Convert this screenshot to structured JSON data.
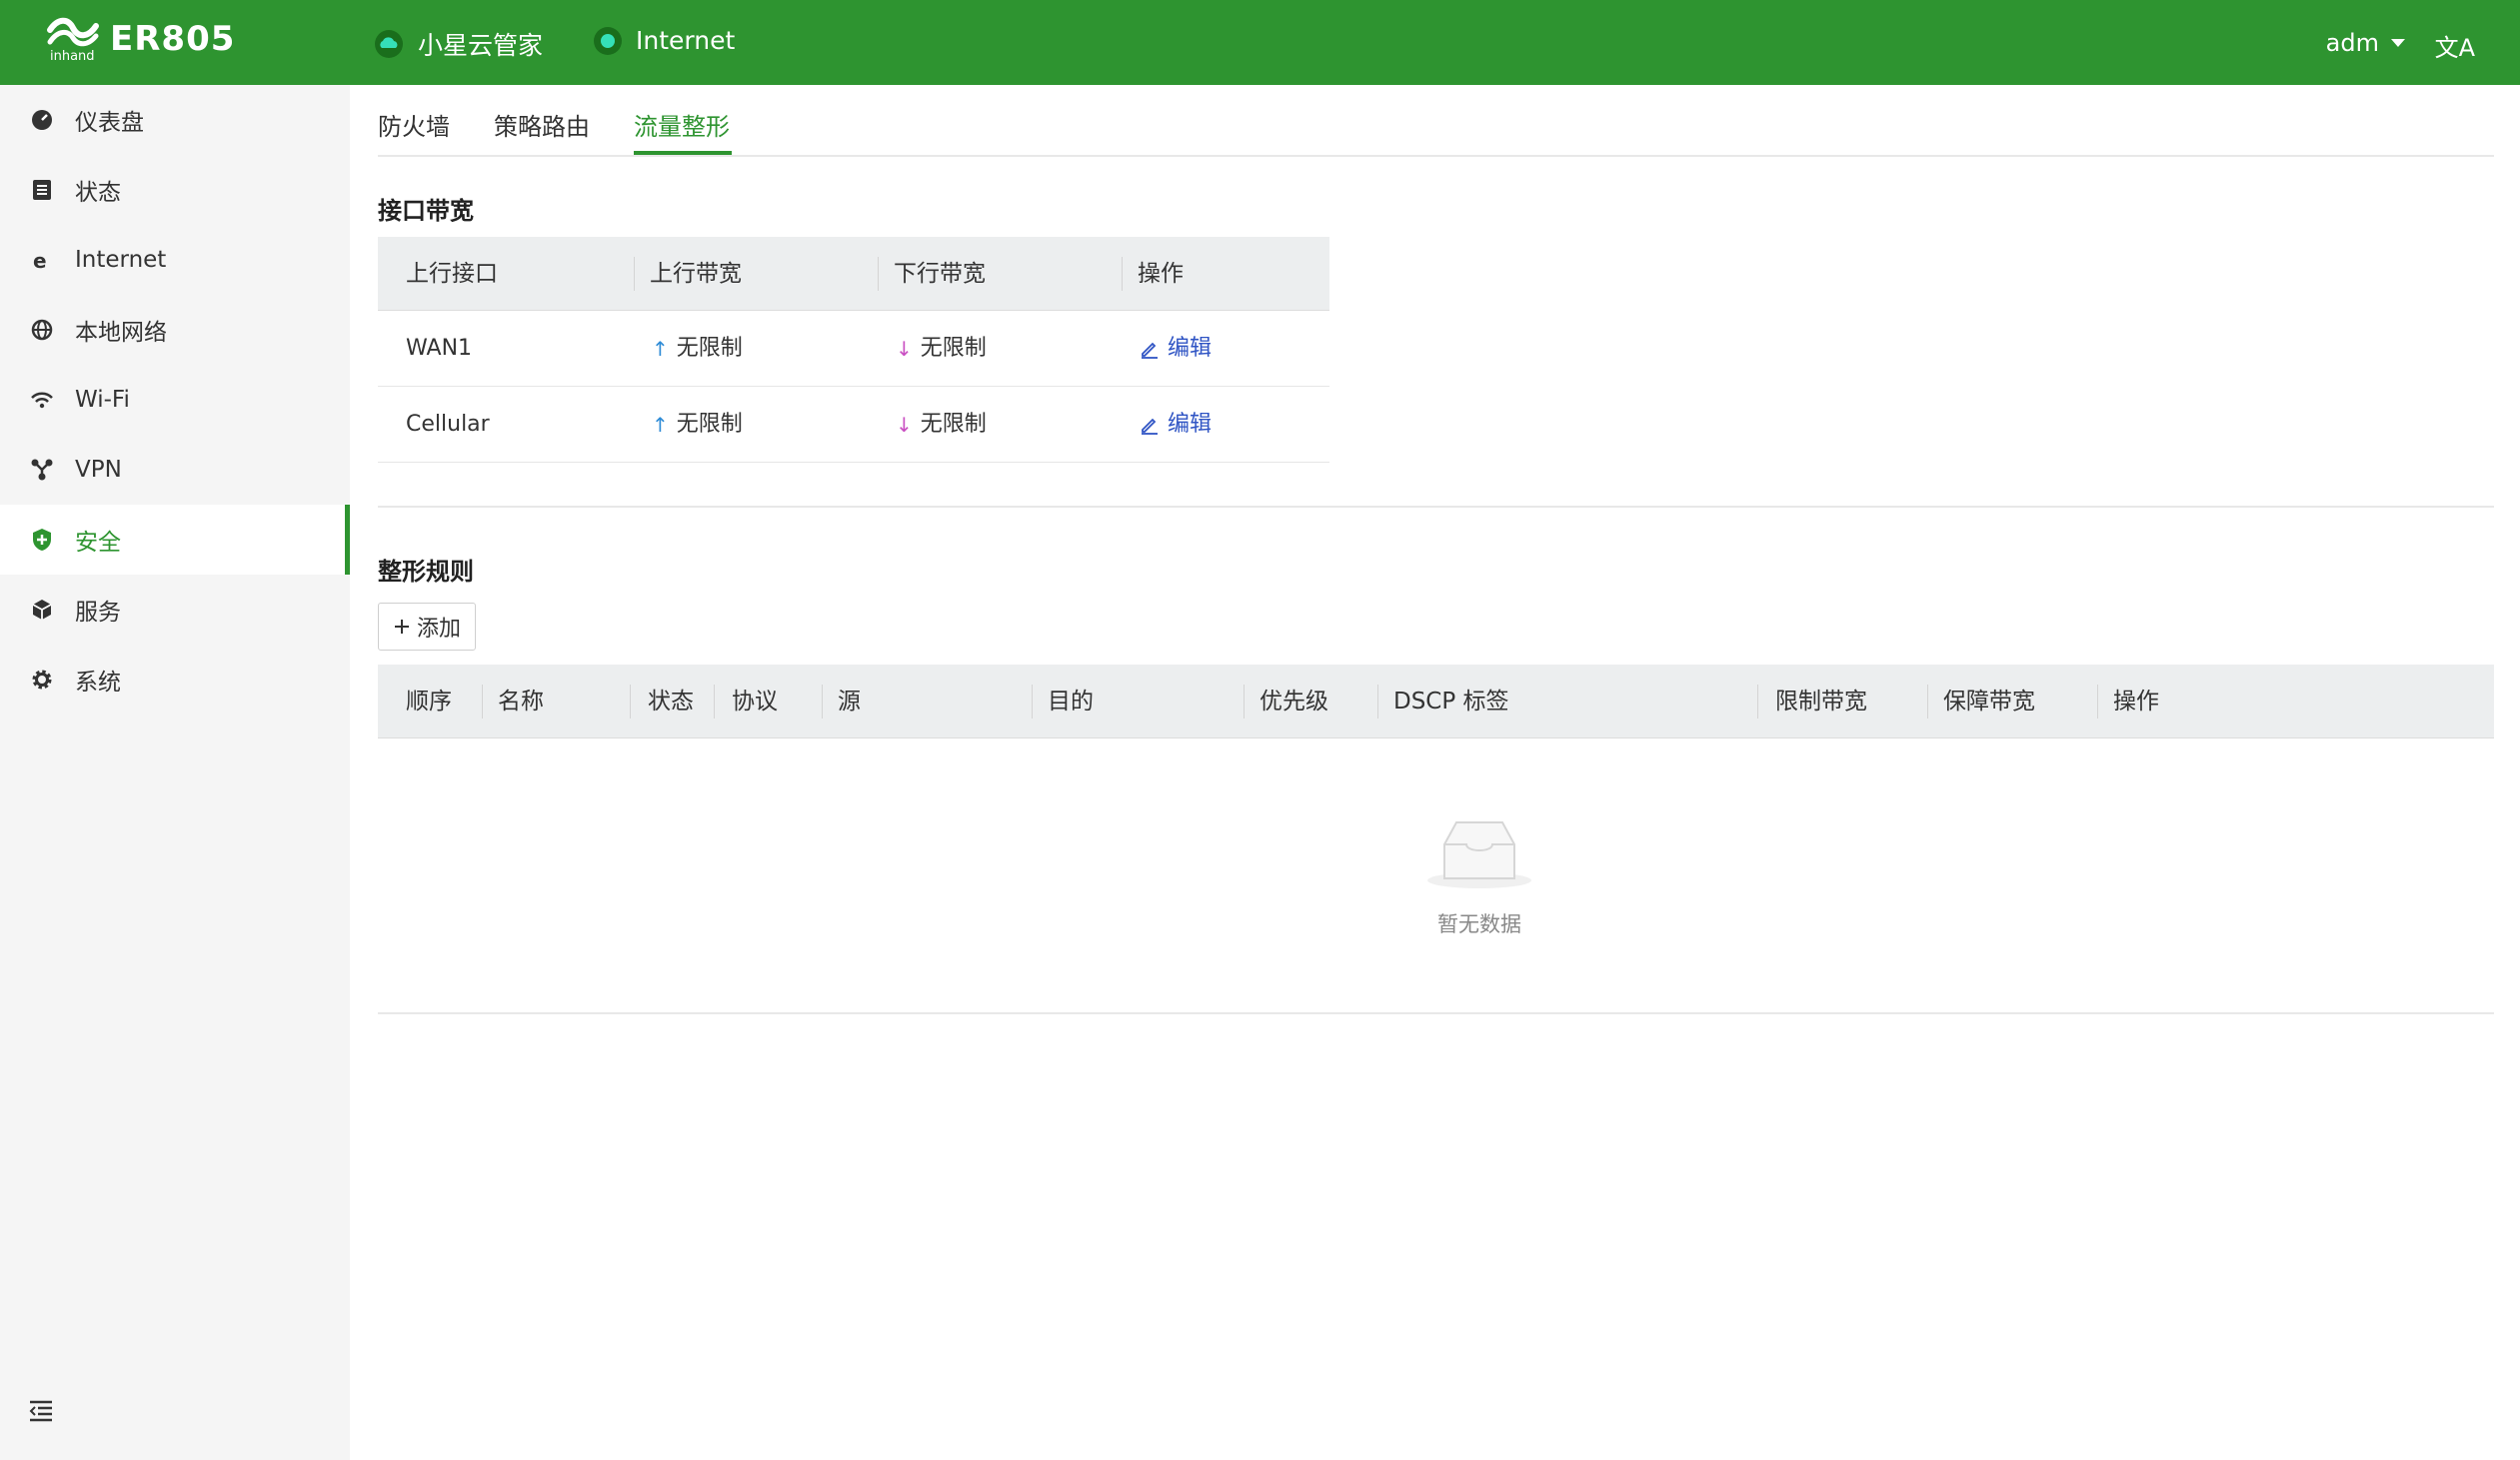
{
  "header": {
    "brand": "ER805",
    "cloud_label": "小星云管家",
    "internet_label": "Internet",
    "user": "adm",
    "lang_icon": "文A"
  },
  "sidebar": {
    "items": [
      {
        "label": "仪表盘",
        "icon": "dashboard-icon"
      },
      {
        "label": "状态",
        "icon": "status-icon"
      },
      {
        "label": "Internet",
        "icon": "internet-icon"
      },
      {
        "label": "本地网络",
        "icon": "globe-icon"
      },
      {
        "label": "Wi-Fi",
        "icon": "wifi-icon"
      },
      {
        "label": "VPN",
        "icon": "vpn-icon"
      },
      {
        "label": "安全",
        "icon": "shield-icon"
      },
      {
        "label": "服务",
        "icon": "cube-icon"
      },
      {
        "label": "系统",
        "icon": "gear-icon"
      }
    ],
    "active_index": 6
  },
  "tabs": [
    "防火墙",
    "策略路由",
    "流量整形"
  ],
  "active_tab": 2,
  "bandwidth": {
    "title": "接口带宽",
    "columns": [
      "上行接口",
      "上行带宽",
      "下行带宽",
      "操作"
    ],
    "rows": [
      {
        "iface": "WAN1",
        "up": "无限制",
        "down": "无限制",
        "action": "编辑"
      },
      {
        "iface": "Cellular",
        "up": "无限制",
        "down": "无限制",
        "action": "编辑"
      }
    ]
  },
  "rules": {
    "title": "整形规则",
    "add_label": "添加",
    "columns": [
      "顺序",
      "名称",
      "状态",
      "协议",
      "源",
      "目的",
      "优先级",
      "DSCP 标签",
      "限制带宽",
      "保障带宽",
      "操作"
    ],
    "empty_text": "暂无数据"
  },
  "colors": {
    "brand_green": "#2e9430",
    "link_blue": "#2f54c4"
  }
}
